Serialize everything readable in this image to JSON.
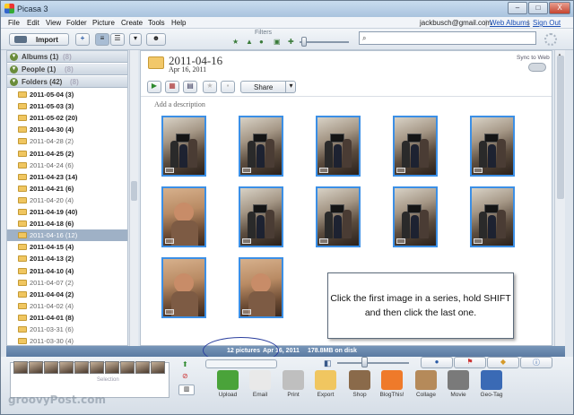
{
  "window": {
    "title": "Picasa 3",
    "minimize": "–",
    "maximize": "□",
    "close": "X"
  },
  "menubar": {
    "items": [
      "File",
      "Edit",
      "View",
      "Folder",
      "Picture",
      "Create",
      "Tools",
      "Help"
    ],
    "account": "jackbusch@gmail.com",
    "separator": "|",
    "web_albums": "Web Albums",
    "sign_out": "Sign Out"
  },
  "toolbar": {
    "import_label": "Import",
    "filters_label": "Filters",
    "search_placeholder": ""
  },
  "sidebar": {
    "sections": [
      {
        "label": "Albums (1)",
        "dim": "(8)"
      },
      {
        "label": "People (1)",
        "dim": "(8)"
      },
      {
        "label": "Folders (42)",
        "dim": "(8)"
      }
    ],
    "folders": [
      {
        "label": "2011-05-04 (3)",
        "bold": true
      },
      {
        "label": "2011-05-03 (3)",
        "bold": true
      },
      {
        "label": "2011-05-02 (20)",
        "bold": true
      },
      {
        "label": "2011-04-30 (4)",
        "bold": true
      },
      {
        "label": "2011-04-28 (2)",
        "bold": false
      },
      {
        "label": "2011-04-25 (2)",
        "bold": true
      },
      {
        "label": "2011-04-24 (6)",
        "bold": false
      },
      {
        "label": "2011-04-23 (14)",
        "bold": true
      },
      {
        "label": "2011-04-21 (6)",
        "bold": true
      },
      {
        "label": "2011-04-20 (4)",
        "bold": false
      },
      {
        "label": "2011-04-19 (40)",
        "bold": true
      },
      {
        "label": "2011-04-18 (6)",
        "bold": true
      },
      {
        "label": "2011-04-16 (12)",
        "bold": false,
        "selected": true
      },
      {
        "label": "2011-04-15 (4)",
        "bold": true
      },
      {
        "label": "2011-04-13 (2)",
        "bold": true
      },
      {
        "label": "2011-04-10 (4)",
        "bold": true
      },
      {
        "label": "2011-04-07 (2)",
        "bold": false
      },
      {
        "label": "2011-04-04 (2)",
        "bold": true
      },
      {
        "label": "2011-04-02 (4)",
        "bold": false
      },
      {
        "label": "2011-04-01 (8)",
        "bold": true
      },
      {
        "label": "2011-03-31 (6)",
        "bold": false
      },
      {
        "label": "2011-03-30 (4)",
        "bold": false
      }
    ]
  },
  "album": {
    "title": "2011-04-16",
    "date": "Apr 16, 2011",
    "sync_label": "Sync to Web",
    "share_label": "Share",
    "description_placeholder": "Add a description"
  },
  "callout": {
    "text": "Click the first image in a series, hold SHIFT and then click the last one."
  },
  "status": {
    "pictures": "12 pictures",
    "date": "Apr 16, 2011",
    "size": "178.8MB on disk"
  },
  "tray": {
    "selection_label": "Selection"
  },
  "actions": [
    "Upload",
    "Email",
    "Print",
    "Export",
    "Shop",
    "BlogThis!",
    "Collage",
    "Movie",
    "Geo-Tag"
  ],
  "watermark": "groovyPost.com",
  "colors": {
    "selection_border": "#3b8fe6",
    "status_bar": "#5b7ba2",
    "highlight_ellipse": "#2b3f9e"
  }
}
